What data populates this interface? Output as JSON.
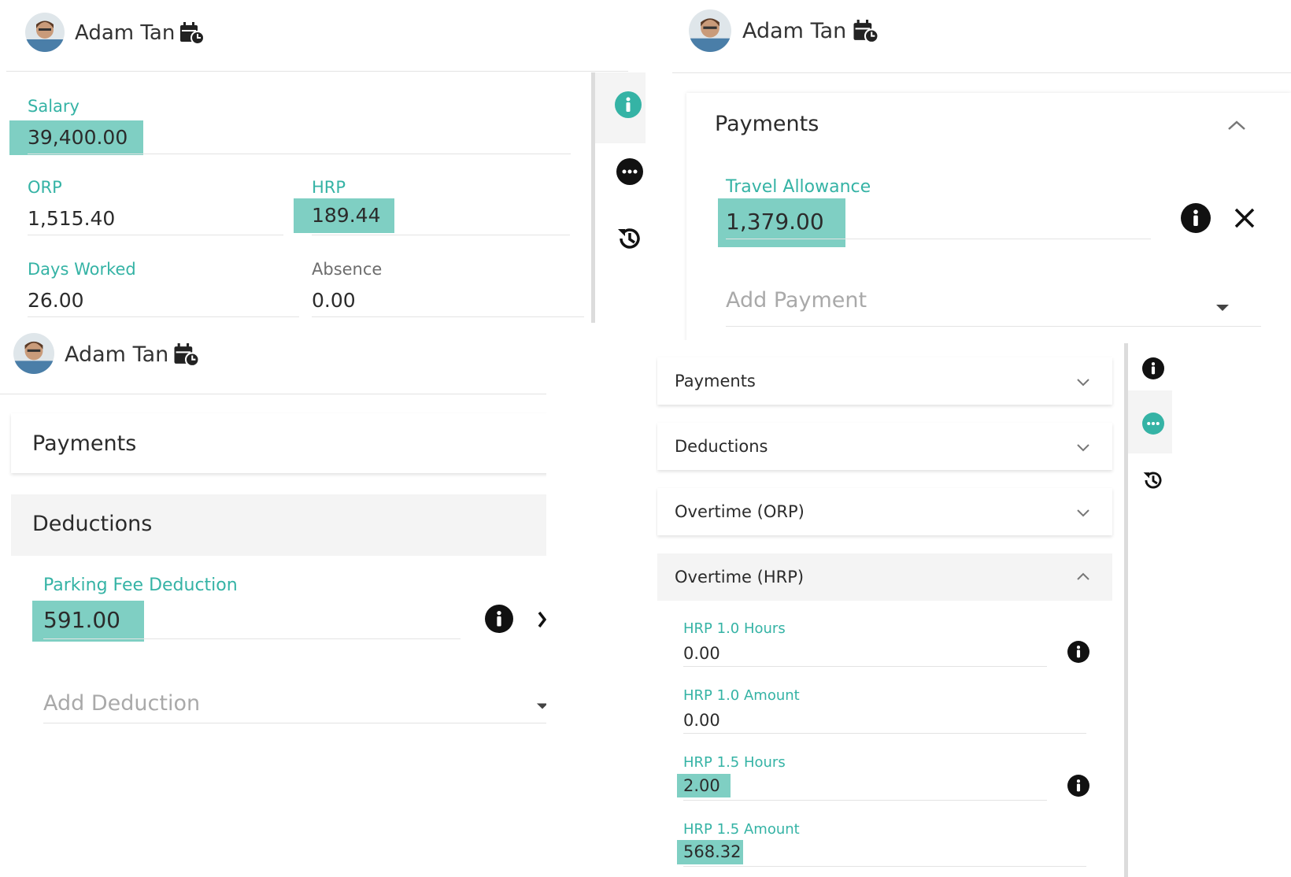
{
  "user": {
    "name": "Adam Tan"
  },
  "salary_panel": {
    "salary": {
      "label": "Salary",
      "value": "39,400.00"
    },
    "orp": {
      "label": "ORP",
      "value": "1,515.40"
    },
    "hrp": {
      "label": "HRP",
      "value": "189.44"
    },
    "days_worked": {
      "label": "Days Worked",
      "value": "26.00"
    },
    "absence": {
      "label": "Absence",
      "value": "0.00"
    }
  },
  "payments_panel": {
    "section_title": "Payments",
    "item": {
      "label": "Travel Allowance",
      "value": "1,379.00"
    },
    "add_placeholder": "Add Payment"
  },
  "deductions_panel": {
    "payments_title": "Payments",
    "deductions_title": "Deductions",
    "item": {
      "label": "Parking Fee Deduction",
      "value": "591.00"
    },
    "add_placeholder": "Add Deduction"
  },
  "overtime_panel": {
    "sections": [
      "Payments",
      "Deductions",
      "Overtime (ORP)",
      "Overtime (HRP)"
    ],
    "fields": [
      {
        "label": "HRP 1.0 Hours",
        "value": "0.00"
      },
      {
        "label": "HRP 1.0 Amount",
        "value": "0.00"
      },
      {
        "label": "HRP 1.5 Hours",
        "value": "2.00"
      },
      {
        "label": "HRP 1.5 Amount",
        "value": "568.32"
      }
    ]
  },
  "colors": {
    "accent": "#35b3a5",
    "highlight": "#7fcfc3"
  },
  "icons": [
    "calendar-clock-icon",
    "info-icon",
    "more-icon",
    "history-icon",
    "close-icon",
    "caret-down-icon",
    "chevron-up-icon",
    "chevron-down-icon"
  ]
}
